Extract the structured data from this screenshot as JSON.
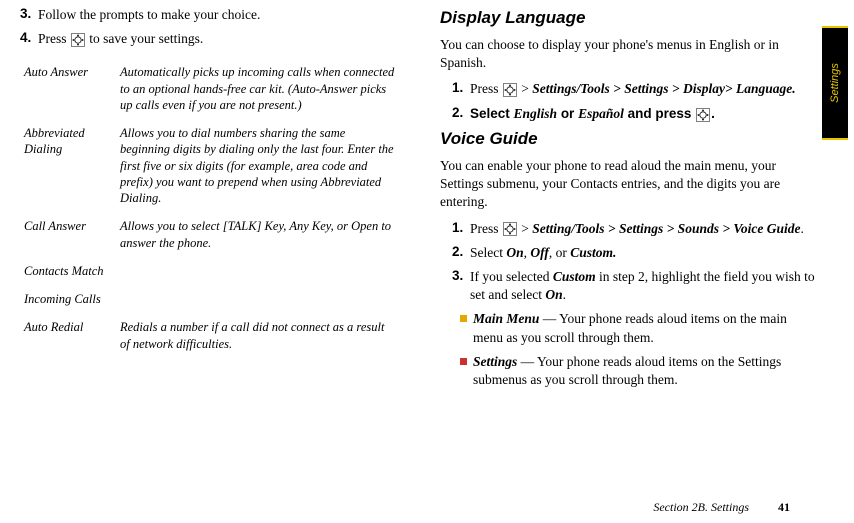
{
  "left": {
    "step3_num": "3.",
    "step3_txt": "Follow the prompts to make your choice.",
    "step4_num": "4.",
    "step4_pre": "Press ",
    "step4_post": " to save your settings.",
    "table": [
      {
        "term": "Auto Answer",
        "desc": "Automatically picks up incoming calls when connected to an optional hands-free car kit. (Auto-Answer picks up calls even if you are not present.)"
      },
      {
        "term": "Abbreviated Dialing",
        "desc": "Allows you to dial numbers sharing the same beginning digits by dialing only the last four. Enter the first five or six digits (for example, area code and prefix) you want to prepend when using Abbreviated Dialing."
      },
      {
        "term": "Call Answer",
        "desc": "Allows you to select [TALK] Key, Any Key, or Open to answer the phone."
      },
      {
        "term": "Contacts Match",
        "desc": ""
      },
      {
        "term": "Incoming Calls",
        "desc": ""
      },
      {
        "term": "Auto Redial",
        "desc": "Redials a number if a call did not connect as a result of network difficulties."
      }
    ]
  },
  "right": {
    "h1": "Display Language",
    "p1": "You can choose to display your phone's menus in English or in Spanish.",
    "dl_step1_num": "1.",
    "dl_step1_pre": "Press ",
    "dl_step1_gt": " > ",
    "dl_step1_path": "Settings/Tools > Settings > Display> Language.",
    "dl_step2_num": "2.",
    "dl_step2_a": "Select ",
    "dl_step2_b": "English",
    "dl_step2_c": " or ",
    "dl_step2_d": "Español",
    "dl_step2_e": " and press ",
    "dl_step2_f": ".",
    "h2": "Voice Guide",
    "p2": "You can enable your phone to read aloud the main menu, your Settings submenu, your Contacts entries, and the digits you are entering.",
    "vg_step1_num": "1.",
    "vg_step1_pre": "Press ",
    "vg_step1_gt": " > ",
    "vg_step1_path": "Setting/Tools > Settings > Sounds > Voice Guide",
    "vg_step1_dot": ".",
    "vg_step2_num": "2.",
    "vg_step2_a": "Select ",
    "vg_step2_b": "On",
    "vg_step2_c": ", ",
    "vg_step2_d": "Off",
    "vg_step2_e": ", or ",
    "vg_step2_f": "Custom.",
    "vg_step3_num": "3.",
    "vg_step3_a": "If you selected ",
    "vg_step3_b": "Custom",
    "vg_step3_c": " in step 2, highlight the field you wish to set and select ",
    "vg_step3_d": "On",
    "vg_step3_e": ".",
    "bullet1_a": "Main Menu",
    "bullet1_b": " — Your phone reads aloud items on the main menu as you scroll through them.",
    "bullet2_a": "Settings",
    "bullet2_b": " — Your phone reads aloud items on the Settings submenus as you scroll through them."
  },
  "footer": {
    "section": "Section 2B. Settings",
    "page": "41"
  },
  "tab": "Settings"
}
